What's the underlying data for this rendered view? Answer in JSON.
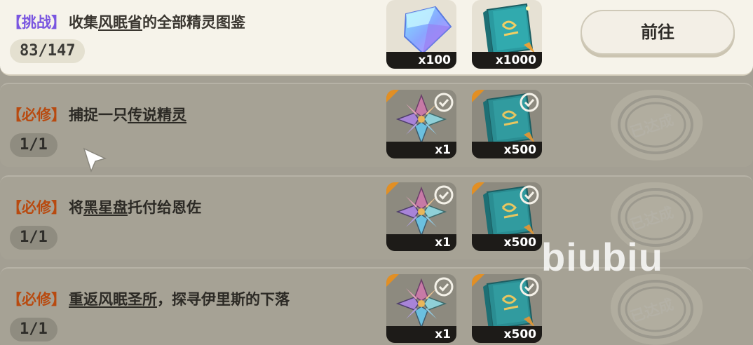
{
  "tasks": [
    {
      "tag_open": "【",
      "tag": "挑战",
      "tag_close": "】",
      "name_pre": "收集",
      "name_link": "风眠省",
      "name_post": "的全部精灵图鉴",
      "progress": "83/147",
      "rewards": [
        {
          "icon": "crystal-icon",
          "qty": "x100"
        },
        {
          "icon": "book-icon",
          "qty": "x1000"
        }
      ],
      "action_label": "前往",
      "completed": false
    },
    {
      "tag_open": "【",
      "tag": "必修",
      "tag_close": "】",
      "name_pre": "捕捉一只",
      "name_link": "传说精灵",
      "name_post": "",
      "progress": "1/1",
      "rewards": [
        {
          "icon": "leaf-emblem-icon",
          "qty": "x1"
        },
        {
          "icon": "book-icon",
          "qty": "x500"
        }
      ],
      "stamp": "已达成",
      "completed": true
    },
    {
      "tag_open": "【",
      "tag": "必修",
      "tag_close": "】",
      "name_pre": "将",
      "name_link": "黑星盘",
      "name_post": "托付给恩佐",
      "progress": "1/1",
      "rewards": [
        {
          "icon": "leaf-emblem-icon",
          "qty": "x1"
        },
        {
          "icon": "book-icon",
          "qty": "x500"
        }
      ],
      "stamp": "已达成",
      "completed": true
    },
    {
      "tag_open": "【",
      "tag": "必修",
      "tag_close": "】",
      "name_pre": "",
      "name_link": "重返风眠圣所",
      "name_post": "，探寻伊里斯的下落",
      "progress": "1/1",
      "rewards": [
        {
          "icon": "leaf-emblem-icon",
          "qty": "x1"
        },
        {
          "icon": "book-icon",
          "qty": "x500"
        }
      ],
      "stamp": "已达成",
      "completed": true
    }
  ],
  "watermark": "biubiu",
  "colors": {
    "challenge_tag": "#7a56e0",
    "required_tag": "#b84a10",
    "active_row": "#f6f3ea",
    "done_row": "#a6a295",
    "corner_badge": "#e28f24"
  }
}
